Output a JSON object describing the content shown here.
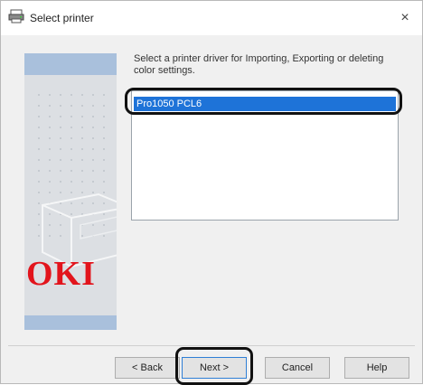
{
  "window": {
    "title": "Select printer",
    "close_glyph": "×"
  },
  "icons": {
    "app": "printer-app-icon",
    "close": "close-icon"
  },
  "colors": {
    "selection": "#1e73d8",
    "logo": "#e2141c",
    "annotation_ring": "#111111"
  },
  "content": {
    "instruction": "Select a printer driver for Importing, Exporting or deleting color settings.",
    "printer_list": [
      {
        "label": "Pro1050 PCL6",
        "selected": true
      }
    ]
  },
  "branding": {
    "logo_text": "OKI"
  },
  "buttons": {
    "back": "< Back",
    "next": "Next >",
    "cancel": "Cancel",
    "help": "Help"
  }
}
